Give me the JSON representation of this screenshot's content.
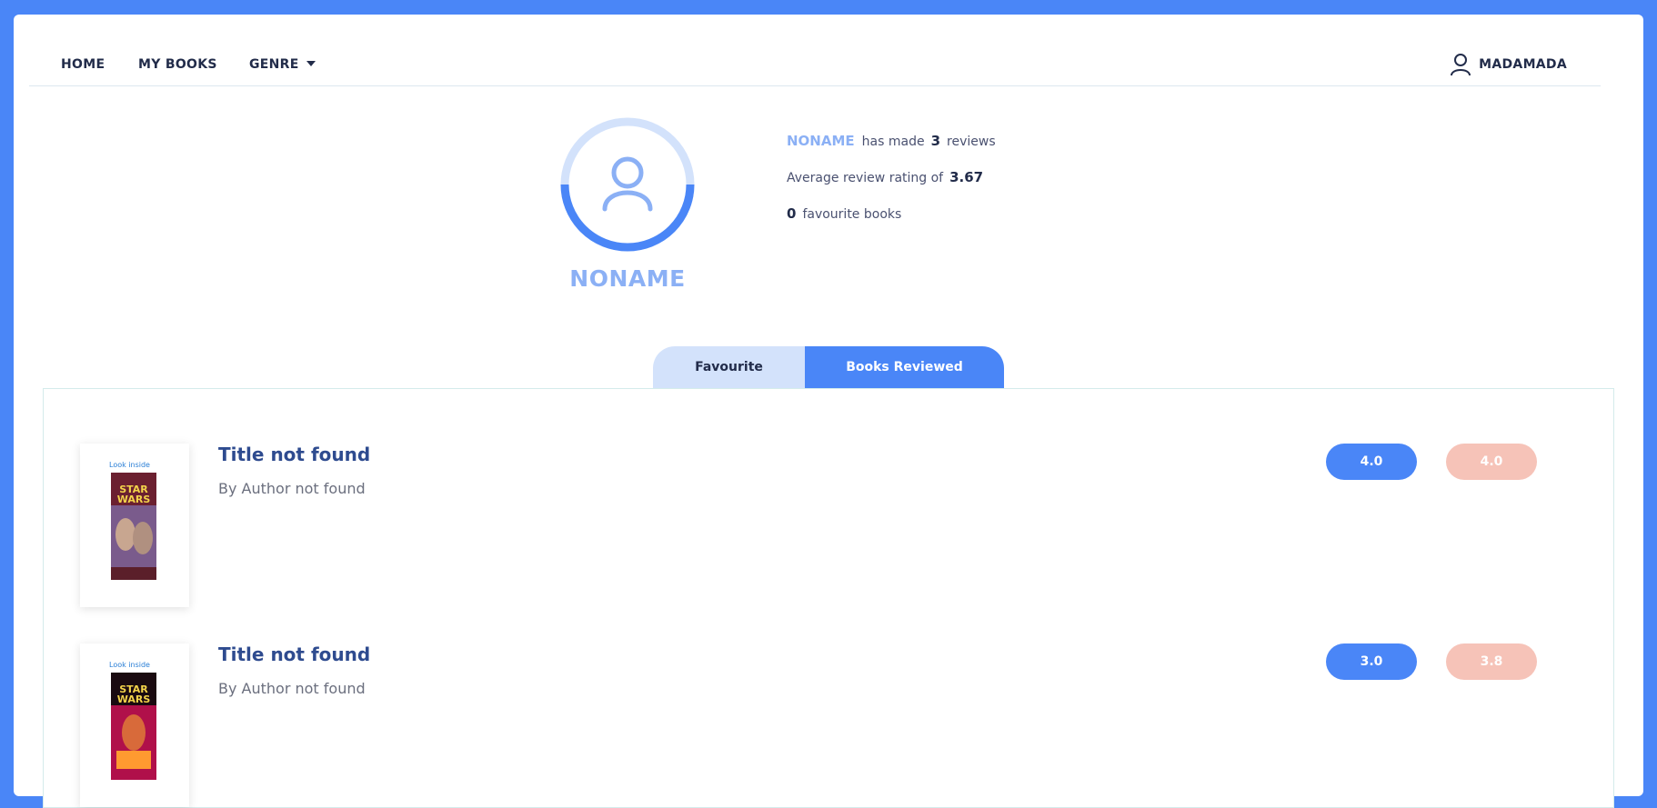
{
  "nav": {
    "home": "HOME",
    "my_books": "MY BOOKS",
    "genre": "GENRE",
    "username": "MADAMADA"
  },
  "profile": {
    "name": "NONAME",
    "has_made": "has made",
    "review_count": "3",
    "reviews_word": "reviews",
    "avg_label": "Average review rating of",
    "avg_value": "3.67",
    "fav_count": "0",
    "fav_label": "favourite books"
  },
  "tabs": {
    "favourite": "Favourite",
    "reviewed": "Books Reviewed"
  },
  "books": [
    {
      "title": "Title not found",
      "author": "By Author not found",
      "user_rating": "4.0",
      "avg_rating": "4.0",
      "cover_text": "Look inside"
    },
    {
      "title": "Title not found",
      "author": "By Author not found",
      "user_rating": "3.0",
      "avg_rating": "3.8",
      "cover_text": "Look inside"
    }
  ],
  "colors": {
    "brand": "#4a86f7",
    "light_brand": "#8bb0f5",
    "avg_pill": "#f6c3b8"
  }
}
